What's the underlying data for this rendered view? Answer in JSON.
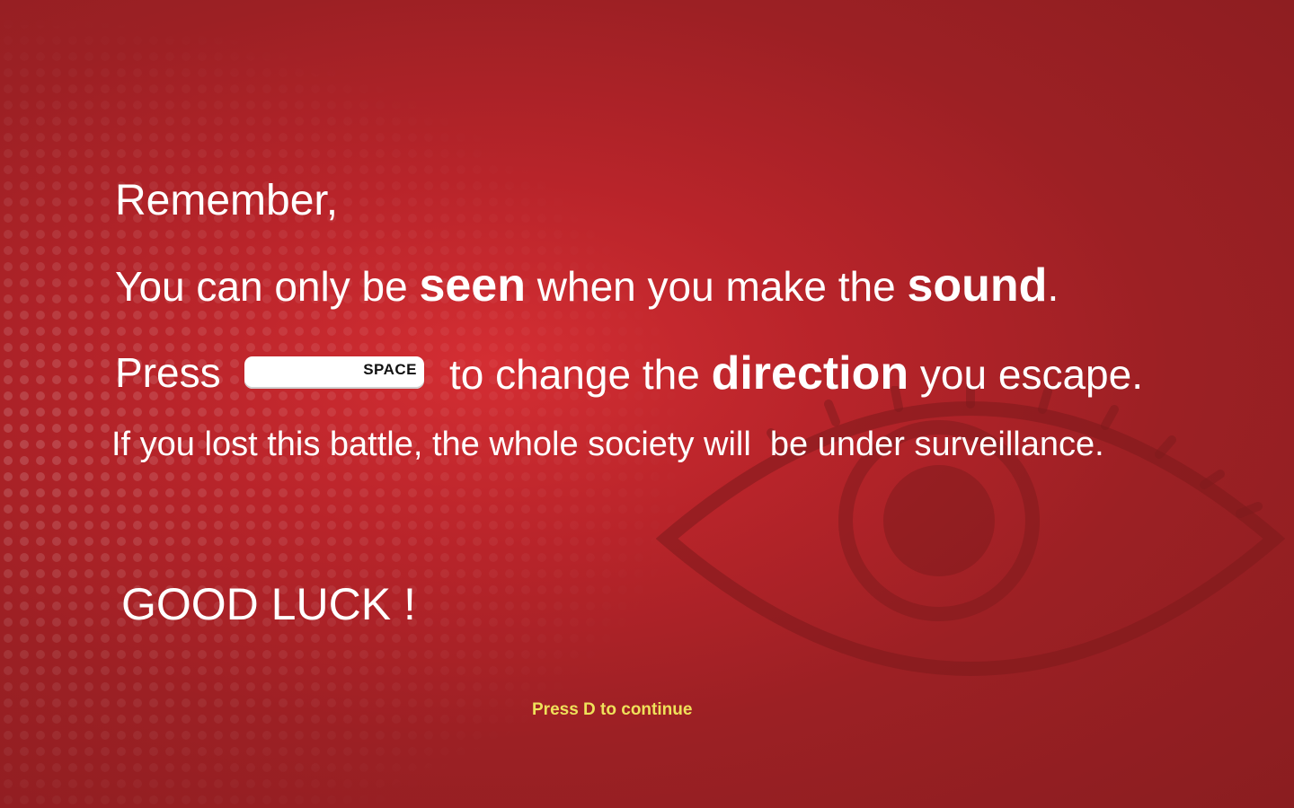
{
  "screen": {
    "line1": "Remember,",
    "line2": {
      "part1": "You can only be ",
      "seen": "seen",
      "part2": " when you make the ",
      "sound": "sound",
      "part3": "."
    },
    "line3": {
      "press": "Press",
      "key_label": "SPACE",
      "part1": "to change the ",
      "direction": "direction",
      "part2": " you escape."
    },
    "line4": "If you lost this battle, the whole society will  be under surveillance.",
    "good_luck": "GOOD LUCK !",
    "continue_prompt": "Press D to continue"
  },
  "colors": {
    "background": "#b8242a",
    "text": "#ffffff",
    "prompt": "#efe15a",
    "eye_shadow": "#7e1a1c"
  },
  "icons": {
    "background_eye": "eye-icon",
    "space_key": "space-key-icon"
  }
}
